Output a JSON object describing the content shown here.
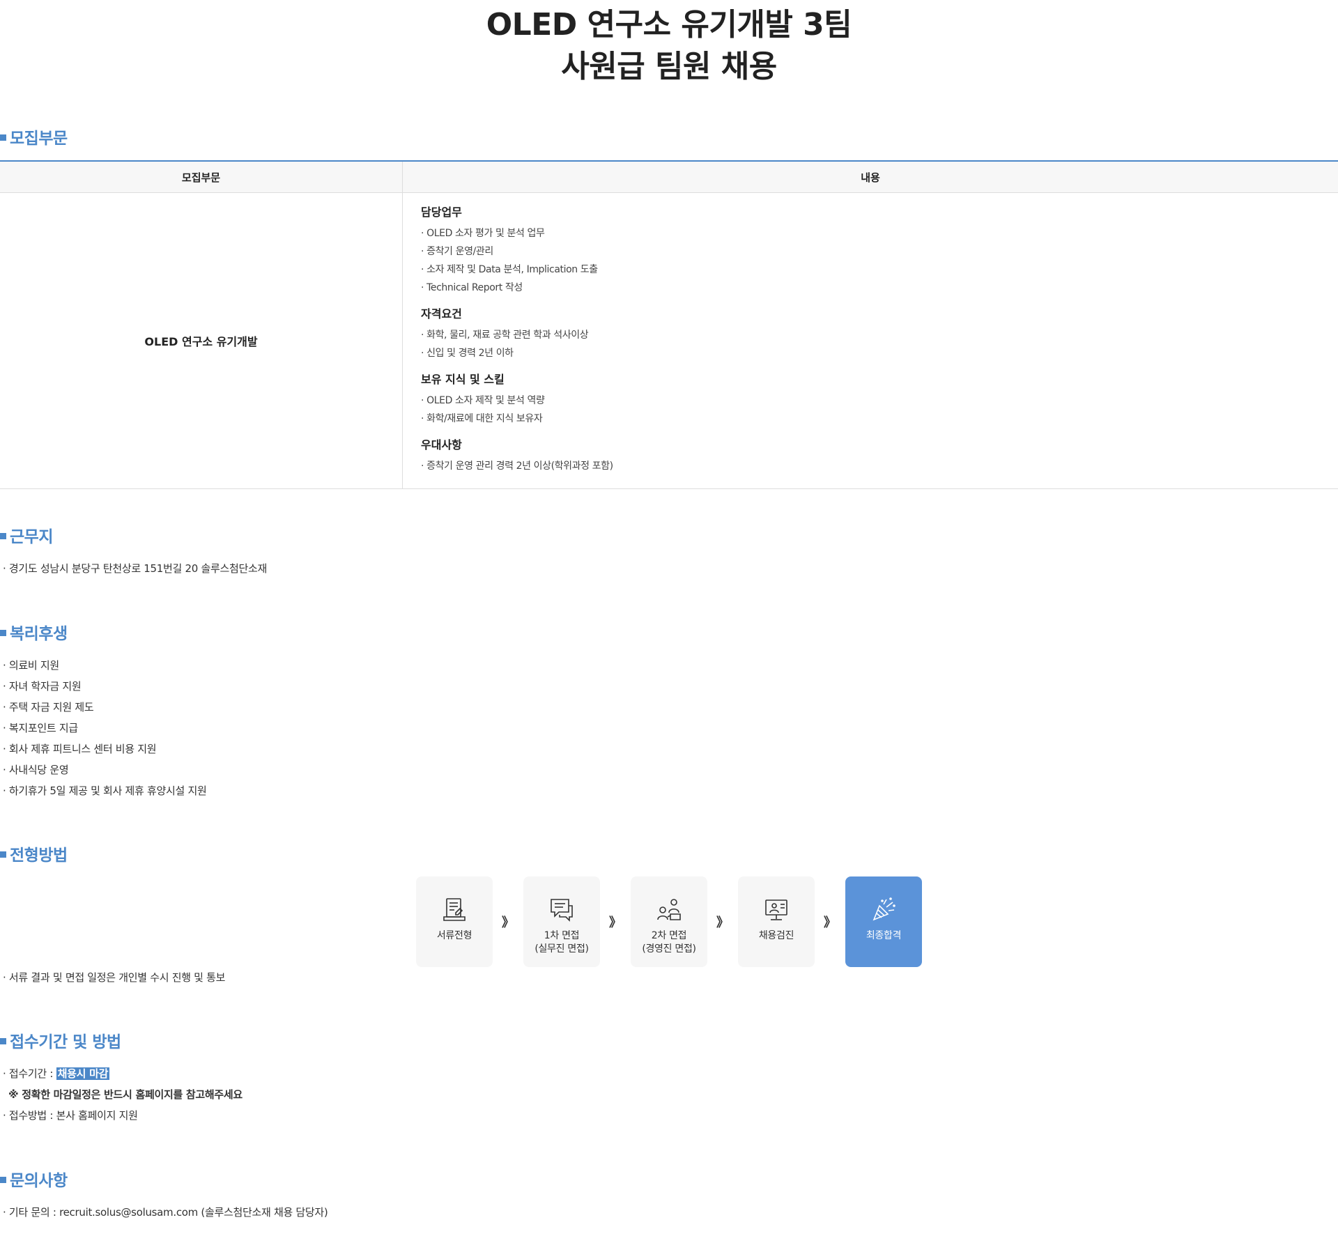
{
  "title": {
    "line1": "OLED 연구소 유기개발 3팀",
    "line2": "사원급 팀원 채용"
  },
  "sections": {
    "recruit": {
      "heading": "모집부문"
    },
    "workplace": {
      "heading": "근무지"
    },
    "welfare": {
      "heading": "복리후생"
    },
    "process": {
      "heading": "전형방법"
    },
    "apply": {
      "heading": "접수기간 및 방법"
    },
    "contact": {
      "heading": "문의사항"
    }
  },
  "table": {
    "headers": [
      "모집부문",
      "내용"
    ],
    "department": "OLED 연구소 유기개발",
    "groups": [
      {
        "title": "담당업무",
        "items": [
          "· OLED 소자 평가 및 분석 업무",
          "· 증착기 운영/관리",
          "· 소자 제작 및 Data 분석, Implication 도출",
          "· Technical Report 작성"
        ]
      },
      {
        "title": "자격요건",
        "items": [
          "· 화학, 물리, 재료 공학 관련 학과 석사이상",
          "· 신입 및 경력 2년 이하"
        ]
      },
      {
        "title": "보유 지식 및 스킬",
        "items": [
          "· OLED 소자 제작 및 분석 역량",
          "· 화학/재료에 대한 지식 보유자"
        ]
      },
      {
        "title": "우대사항",
        "items": [
          "· 증착기 운영 관리 경력 2년 이상(학위과정 포함)"
        ]
      }
    ]
  },
  "workplace": {
    "address": "· 경기도 성남시 분당구 탄천상로 151번길 20 솔루스첨단소재"
  },
  "welfare": {
    "items": [
      "· 의료비 지원",
      "· 자녀 학자금 지원",
      "· 주택 자금 지원 제도",
      "· 복지포인트 지급",
      "· 회사 제휴 피트니스 센터 비용 지원",
      "· 사내식당 운영",
      "· 하기휴가 5일 제공 및 회사 제휴 휴양시설 지원"
    ]
  },
  "process": {
    "steps": [
      {
        "label": "서류전형",
        "icon": "document-icon"
      },
      {
        "label": "1차 면접\n(실무진 면접)",
        "icon": "chat-icon"
      },
      {
        "label": "2차 면접\n(경영진 면접)",
        "icon": "people-icon"
      },
      {
        "label": "채용검진",
        "icon": "monitor-person-icon"
      },
      {
        "label": "최종합격",
        "icon": "party-popper-icon"
      }
    ],
    "arrow": "》",
    "note": "· 서류 결과 및 면접 일정은 개인별 수시 진행 및 통보"
  },
  "apply": {
    "period_label": "· 접수기간 : ",
    "period_value": "채용시 마감",
    "notice": "※ 정확한 마감일정은 반드시 홈페이지를 참고해주세요",
    "method": "· 접수방법 : 본사 홈페이지 지원"
  },
  "contact": {
    "text": "· 기타 문의 : recruit.solus@solusam.com (솔루스첨단소재 채용 담당자)"
  },
  "colors": {
    "accent": "#4b87c8",
    "final_step": "#5b93d9"
  }
}
